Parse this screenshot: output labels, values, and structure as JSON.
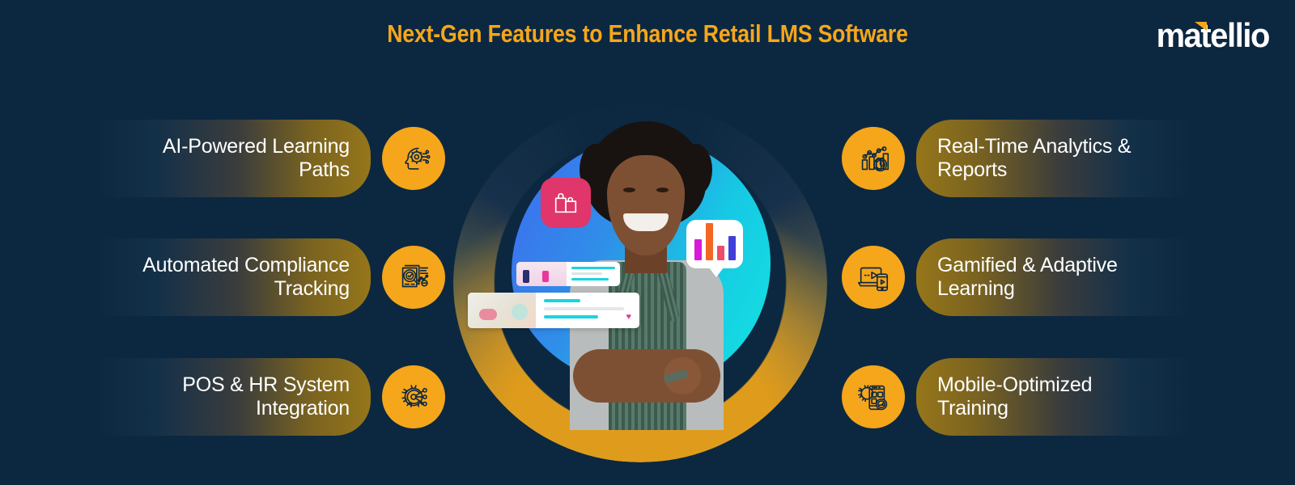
{
  "header": {
    "title": "Next-Gen Features to Enhance Retail LMS Software",
    "logo_text": "matellio"
  },
  "colors": {
    "background": "#0C2840",
    "accent": "#F6A61B",
    "pill_gold": "#96761A",
    "icon_circle": "#F6A61B",
    "text": "#FFFFFF",
    "card_pink": "#E0366B",
    "card_cyan": "#19D4E0"
  },
  "features_left": [
    {
      "label": "AI-Powered Learning\nPaths",
      "icon": "ai-head-gear-icon"
    },
    {
      "label": "Automated Compliance\nTracking",
      "icon": "document-magnifier-check-icon"
    },
    {
      "label": "POS & HR System\nIntegration",
      "icon": "gear-network-icon"
    }
  ],
  "features_right": [
    {
      "label": "Real-Time Analytics &\nReports",
      "icon": "bar-chart-clock-icon"
    },
    {
      "label": "Gamified & Adaptive\nLearning",
      "icon": "laptop-phone-play-icon"
    },
    {
      "label": "Mobile-Optimized\nTraining",
      "icon": "mobile-gear-speedometer-icon"
    }
  ],
  "hero": {
    "alt": "smiling retail employee wearing apron with arms crossed",
    "cards": [
      {
        "name": "shopping-bag-card",
        "color": "#E0366B"
      },
      {
        "name": "bar-chart-speech-bubble",
        "bars": [
          "#D81AD8",
          "#F26722",
          "#EE4C6A",
          "#4040D8"
        ]
      },
      {
        "name": "course-card-shopping",
        "thumb": "retail-shoppers-illustration"
      },
      {
        "name": "course-card-food",
        "thumb": "food-flatlay-illustration"
      }
    ]
  }
}
